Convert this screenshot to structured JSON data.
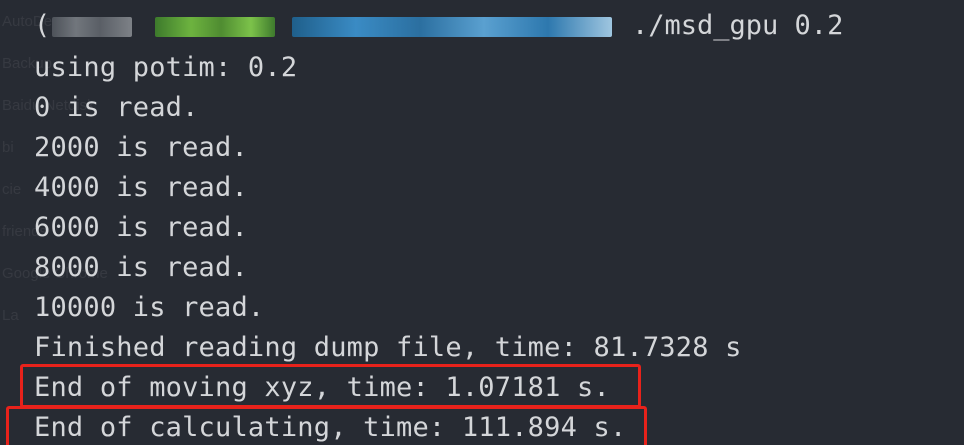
{
  "background_ghost_text": [
    "AutoDe",
    "Backup",
    "Baidu Netdisk",
    "bi",
    "cie",
    "friends",
    "Google Chrome",
    "La",
    "",
    "",
    ""
  ],
  "prompt": {
    "command": "./msd_gpu 0.2"
  },
  "output_lines": [
    "using potim: 0.2",
    "0 is read.",
    "2000 is read.",
    "4000 is read.",
    "6000 is read.",
    "8000 is read.",
    "10000 is read.",
    "Finished reading dump file, time: 81.7328 s"
  ],
  "highlighted_lines": [
    "End of moving xyz, time: 1.07181 s.",
    "End of calculating, time: 111.894 s."
  ],
  "colors": {
    "background": "#272b33",
    "text": "#d4d6d9",
    "highlight_border": "#e8221b"
  }
}
